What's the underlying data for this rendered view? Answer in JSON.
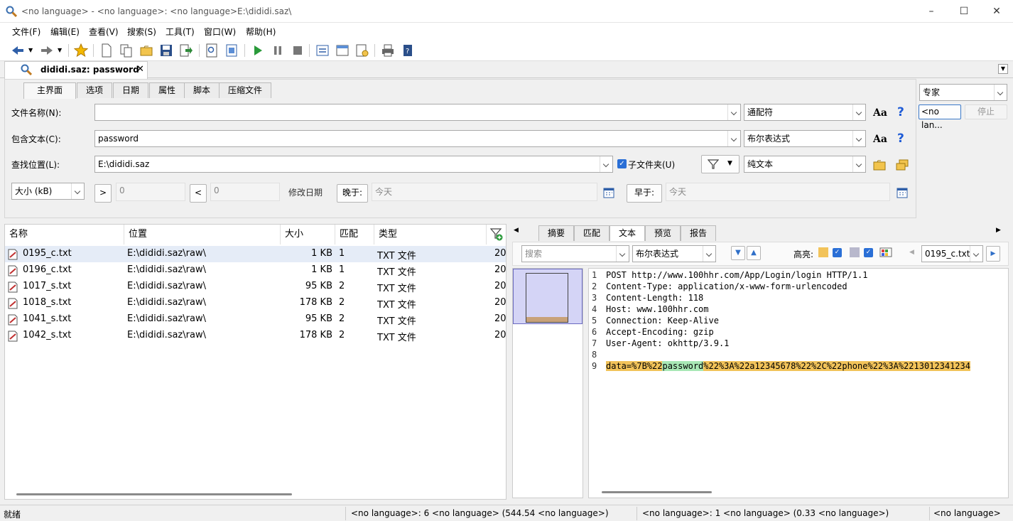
{
  "window": {
    "title": "<no language> - <no language>: <no language>E:\\dididi.saz\\"
  },
  "menu": [
    "文件(F)",
    "编辑(E)",
    "查看(V)",
    "搜索(S)",
    "工具(T)",
    "窗口(W)",
    "帮助(H)"
  ],
  "doc_tab": {
    "label": "dididi.saz: password"
  },
  "search_tabs": [
    "主界面",
    "选项",
    "日期",
    "属性",
    "脚本",
    "压缩文件"
  ],
  "form": {
    "filename_label": "文件名称(N):",
    "filename_value": "",
    "filename_mode": "通配符",
    "contains_label": "包含文本(C):",
    "contains_value": "password",
    "contains_mode": "布尔表达式",
    "location_label": "查找位置(L):",
    "location_value": "E:\\dididi.saz",
    "subfolders_label": "子文件夹(U)",
    "subfolders_checked": true,
    "encoding_mode": "纯文本",
    "size_unit": "大小 (kB)",
    "gt_label": ">",
    "gt_value": "0",
    "lt_label": "<",
    "lt_value": "0",
    "modified_label": "修改日期",
    "after_label": "晚于:",
    "after_value": "今天",
    "before_label": "早于:",
    "before_value": "今天"
  },
  "expert": {
    "mode": "专家",
    "lang_button": "<no lan...",
    "stop_button": "停止"
  },
  "results": {
    "columns": [
      "名称",
      "位置",
      "大小",
      "匹配",
      "类型"
    ],
    "rows": [
      {
        "name": "0195_c.txt",
        "location": "E:\\dididi.saz\\raw\\",
        "size": "1 KB",
        "match": "1",
        "type": "TXT 文件",
        "extra": "20"
      },
      {
        "name": "0196_c.txt",
        "location": "E:\\dididi.saz\\raw\\",
        "size": "1 KB",
        "match": "1",
        "type": "TXT 文件",
        "extra": "20"
      },
      {
        "name": "1017_s.txt",
        "location": "E:\\dididi.saz\\raw\\",
        "size": "95 KB",
        "match": "2",
        "type": "TXT 文件",
        "extra": "20"
      },
      {
        "name": "1018_s.txt",
        "location": "E:\\dididi.saz\\raw\\",
        "size": "178 KB",
        "match": "2",
        "type": "TXT 文件",
        "extra": "20"
      },
      {
        "name": "1041_s.txt",
        "location": "E:\\dididi.saz\\raw\\",
        "size": "95 KB",
        "match": "2",
        "type": "TXT 文件",
        "extra": "20"
      },
      {
        "name": "1042_s.txt",
        "location": "E:\\dididi.saz\\raw\\",
        "size": "178 KB",
        "match": "2",
        "type": "TXT 文件",
        "extra": "20"
      }
    ]
  },
  "preview": {
    "tabs": [
      "摘要",
      "匹配",
      "文本",
      "预览",
      "报告"
    ],
    "active_tab": "文本",
    "search_placeholder": "搜索",
    "search_mode": "布尔表达式",
    "highlight_label": "高亮:",
    "file_select": "0195_c.txt",
    "lines": [
      "POST http://www.100hhr.com/App/Login/login HTTP/1.1",
      "Content-Type: application/x-www-form-urlencoded",
      "Content-Length: 118",
      "Host: www.100hhr.com",
      "Connection: Keep-Alive",
      "Accept-Encoding: gzip",
      "User-Agent: okhttp/3.9.1",
      ""
    ],
    "line9_pre": "data=%7B%22",
    "line9_match": "password",
    "line9_post": "%22%3A%22a12345678%22%2C%22phone%22%3A%2213012341234"
  },
  "status": {
    "left": "就绪",
    "mid1": "<no language>: 6 <no language> (544.54 <no language>)",
    "mid2": "<no language>: 1 <no language> (0.33 <no language>)",
    "right": "<no language>"
  }
}
